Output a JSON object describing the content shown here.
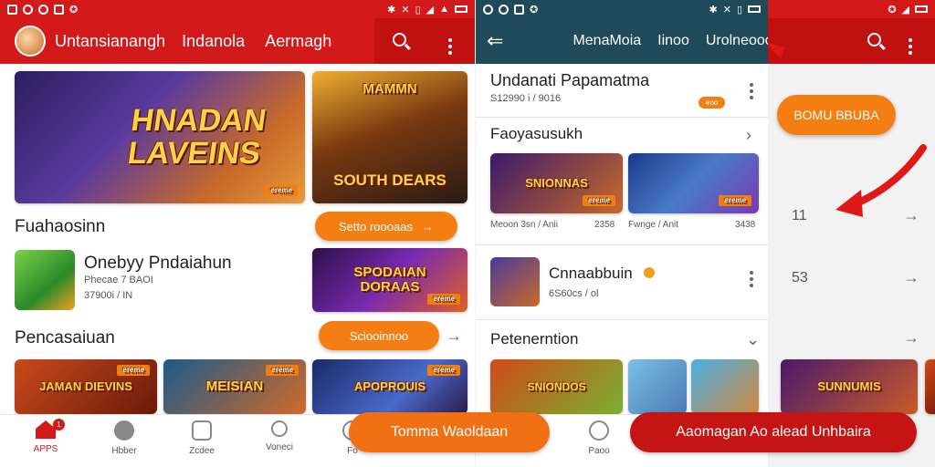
{
  "left": {
    "status_icons": [
      "app-icon",
      "messenger-icon",
      "circle-icon",
      "image-icon",
      "gamepad-icon"
    ],
    "status_right": [
      "bluetooth-icon",
      "mute-icon",
      "vibrate-icon",
      "wifi-icon",
      "signal-icon",
      "battery-icon"
    ],
    "title": "Untansianangh",
    "tab1": "Indanola",
    "tab2": "Aermagh",
    "hero_left": {
      "text": "HNADAN LAVEINS",
      "tag": "ereme"
    },
    "hero_right": {
      "text_top": "MAMMN",
      "text_bottom": "SOUTH DEARS",
      "tag": ""
    },
    "section1": "Fuahaosinn",
    "pill1": "Setto roooaas",
    "app": {
      "name": "Onebyy Pndaiahun",
      "sub1": "Phecae 7 BAOI",
      "sub2": "37900i / IN"
    },
    "card_mid": {
      "text": "SPODAIAN DORAAS",
      "tag": "ereme"
    },
    "section2": "Pencasaiuan",
    "pill2": "Sciooinnoo",
    "row_cards": [
      {
        "text": "JAMAN DIEVINS",
        "tag": "ereme"
      },
      {
        "text": "MEISIAN",
        "tag": "ereme"
      },
      {
        "text": "APOPROUIS",
        "tag": "ereme"
      }
    ],
    "nav": [
      {
        "label": "APPS",
        "icon": "home-icon",
        "badge": "1"
      },
      {
        "label": "Hbber",
        "icon": "chat-icon"
      },
      {
        "label": "Zcdee",
        "icon": "edit-icon"
      },
      {
        "label": "Voneci",
        "icon": "search-icon"
      },
      {
        "label": "Fo",
        "icon": "user-icon"
      }
    ]
  },
  "mid": {
    "status_icons": [
      "messenger-icon",
      "circle-icon",
      "image-icon",
      "gamepad-icon"
    ],
    "status_right": [
      "bluetooth-icon",
      "mute-icon",
      "vibrate-icon",
      "battery-icon"
    ],
    "tab1": "MenaMoia",
    "tab2": "Iinoo",
    "tab3": "Urolneooo",
    "top_title": "Undanati Papamatma",
    "top_sub": "S12990 i / 9016",
    "top_tag": "eoo",
    "section1": "Faoyasusukh",
    "cards": [
      {
        "text": "SNIONNAS",
        "tag": "ereme",
        "name": "Meoon 3sn / Anii",
        "num": "2358"
      },
      {
        "text": "",
        "tag": "ereme",
        "name": "Fwnge / Anit",
        "num": "3438"
      }
    ],
    "app": {
      "name": "Cnnaabbuin",
      "sub": "6S60cs / ol"
    },
    "section2": "Petenerntion",
    "bottom_cards": [
      {
        "text": "SNIONDOS"
      },
      {
        "text": ""
      },
      {
        "text": ""
      },
      {
        "text": ""
      }
    ],
    "nav": [
      {
        "label": "Paoo",
        "icon": "user-icon"
      }
    ]
  },
  "right": {
    "pill": "BOMU BBUBA",
    "row1": "11",
    "row2": "53",
    "card": {
      "text": "SUNNUMIS"
    }
  },
  "bottom_buttons": {
    "left": "Tomma Waoldaan",
    "right": "Aaomagan Ao alead Unhbaira"
  },
  "colors": {
    "brand_red": "#d31a1a",
    "accent_orange": "#f57e13",
    "teal": "#1f4a5a"
  }
}
